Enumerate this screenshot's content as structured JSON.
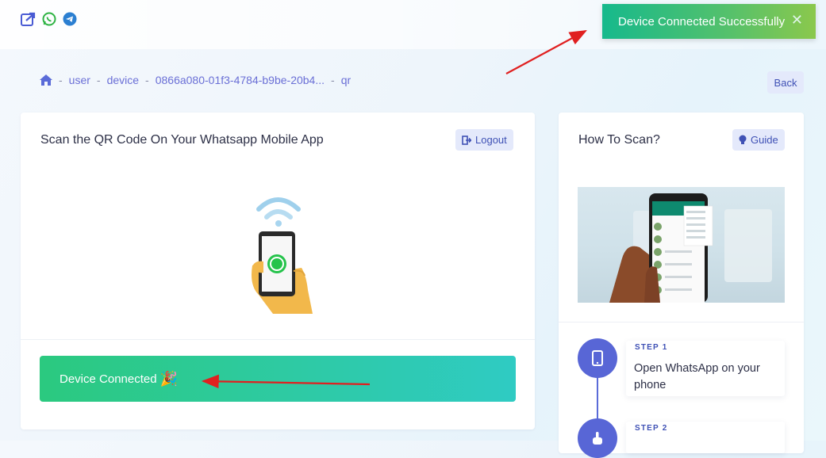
{
  "toast": {
    "message": "Device Connected Successfully",
    "close_glyph": "✕"
  },
  "top_icons": [
    "share-icon",
    "whatsapp-icon",
    "telegram-icon"
  ],
  "breadcrumb": {
    "items": [
      "user",
      "device",
      "0866a080-01f3-4784-b9be-20b4...",
      "qr"
    ],
    "separator": "-"
  },
  "back_button": {
    "label": "Back"
  },
  "qr_card": {
    "title": "Scan the QR Code On Your Whatsapp Mobile App",
    "logout_label": "Logout",
    "status_text": "Device Connected",
    "status_emoji": "🎉"
  },
  "guide_card": {
    "title": "How To Scan?",
    "guide_label": "Guide",
    "steps": [
      {
        "label": "STEP 1",
        "text": "Open WhatsApp on your phone"
      },
      {
        "label": "STEP 2",
        "text": ""
      }
    ]
  },
  "colors": {
    "accent": "#3f51b5",
    "success": "#2bc97f",
    "annotation": "#e02020"
  }
}
